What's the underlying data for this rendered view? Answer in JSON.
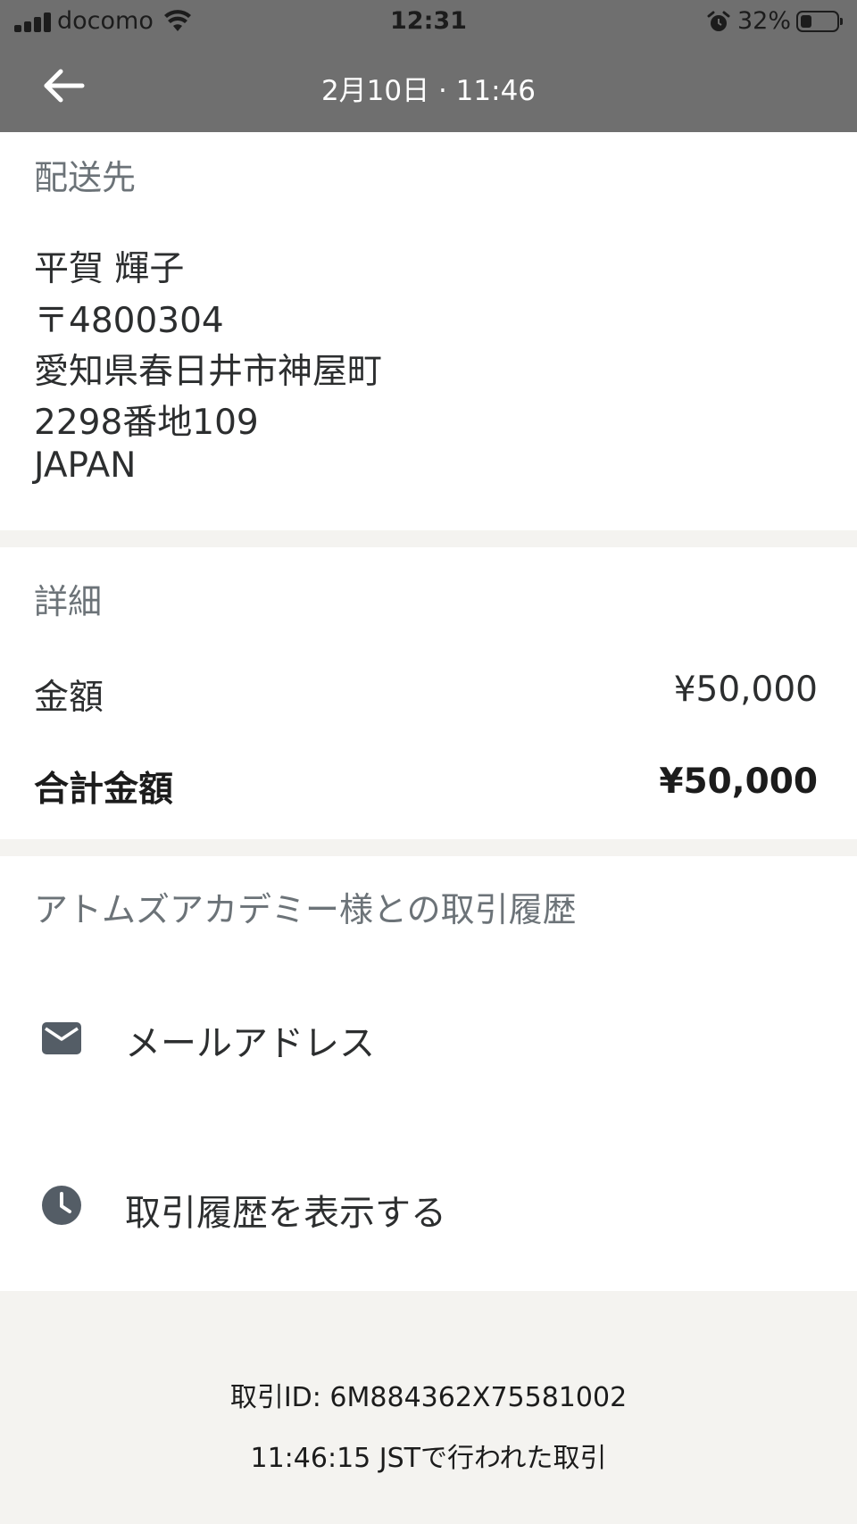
{
  "status_bar": {
    "carrier": "docomo",
    "time": "12:31",
    "battery_percent": "32%",
    "battery_level": 0.32
  },
  "header": {
    "title": "2月10日 · 11:46"
  },
  "shipping": {
    "label": "配送先",
    "lines": [
      "平賀 輝子",
      "〒4800304",
      "愛知県春日井市神屋町",
      "2298番地109",
      "JAPAN"
    ]
  },
  "details": {
    "label": "詳細",
    "amount_label": "金額",
    "amount_value": "¥50,000",
    "total_label": "合計金額",
    "total_value": "¥50,000"
  },
  "history": {
    "label": "アトムズアカデミー様との取引履歴",
    "items": [
      {
        "label": "メールアドレス",
        "icon": "mail-icon"
      },
      {
        "label": "取引履歴を表示する",
        "icon": "clock-icon"
      }
    ]
  },
  "footer": {
    "transaction_id": "取引ID: 6M884362X75581002",
    "time_note": "11:46:15 JSTで行われた取引"
  }
}
